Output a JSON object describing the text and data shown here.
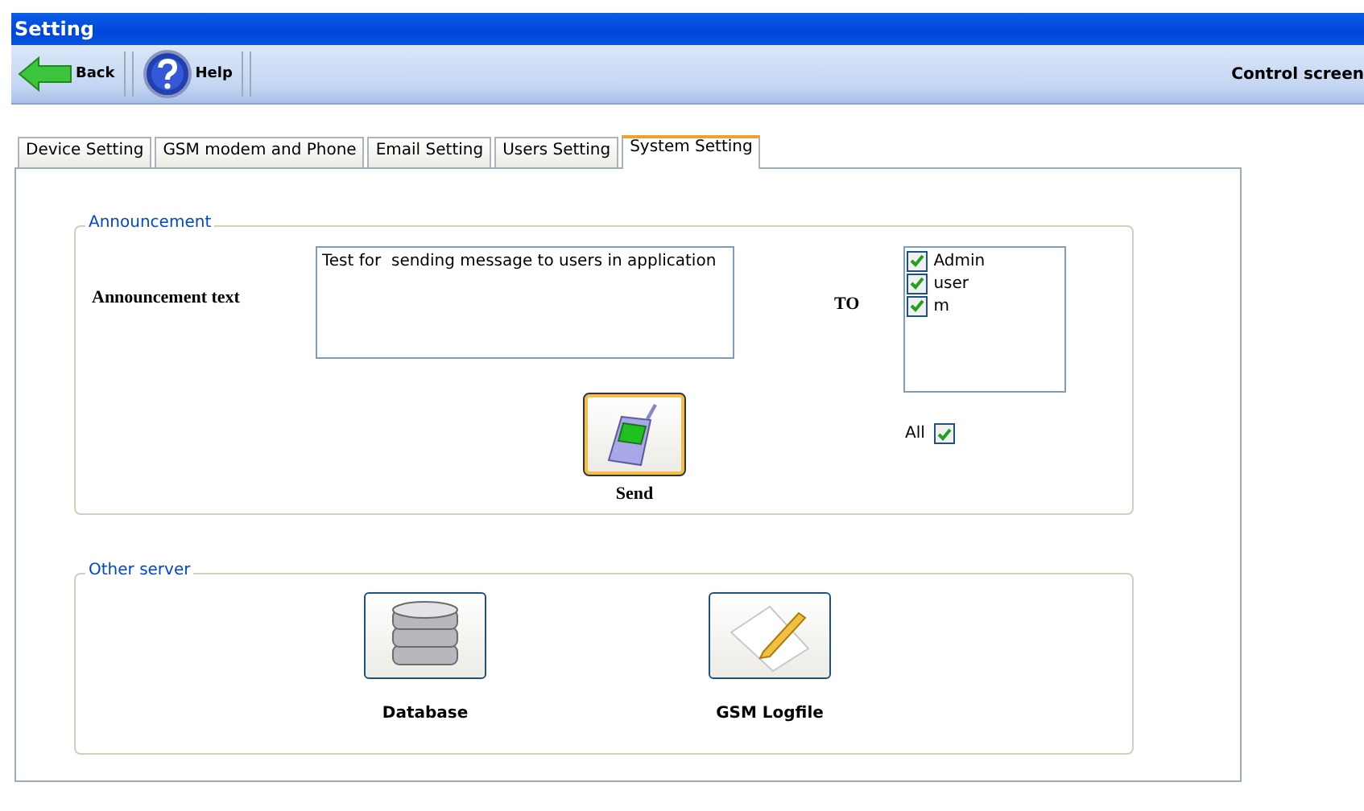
{
  "window": {
    "title": "Setting"
  },
  "toolbar": {
    "buttons": [
      {
        "kind": "back",
        "label": "Back"
      },
      {
        "kind": "help",
        "label": "Help"
      }
    ],
    "screen_name": "Control screen"
  },
  "tabs": [
    {
      "label": "Device Setting",
      "selected": false
    },
    {
      "label": "GSM modem and Phone",
      "selected": false
    },
    {
      "label": "Email Setting",
      "selected": false
    },
    {
      "label": "Users Setting",
      "selected": false
    },
    {
      "label": "System Setting",
      "selected": true
    }
  ],
  "announcement": {
    "legend": "Announcement",
    "text_label": "Announcement text",
    "text_value": "Test for  sending message to users in application",
    "to_label": "TO",
    "recipients": [
      {
        "label": "Admin",
        "checked": true
      },
      {
        "label": "user",
        "checked": true
      },
      {
        "label": "m",
        "checked": true
      }
    ],
    "send_label": "Send",
    "all": {
      "label": "All",
      "checked": true
    }
  },
  "other_server": {
    "legend": "Other server",
    "buttons": [
      {
        "kind": "database",
        "label": "Database"
      },
      {
        "kind": "logfile",
        "label": "GSM Logfile"
      }
    ]
  }
}
